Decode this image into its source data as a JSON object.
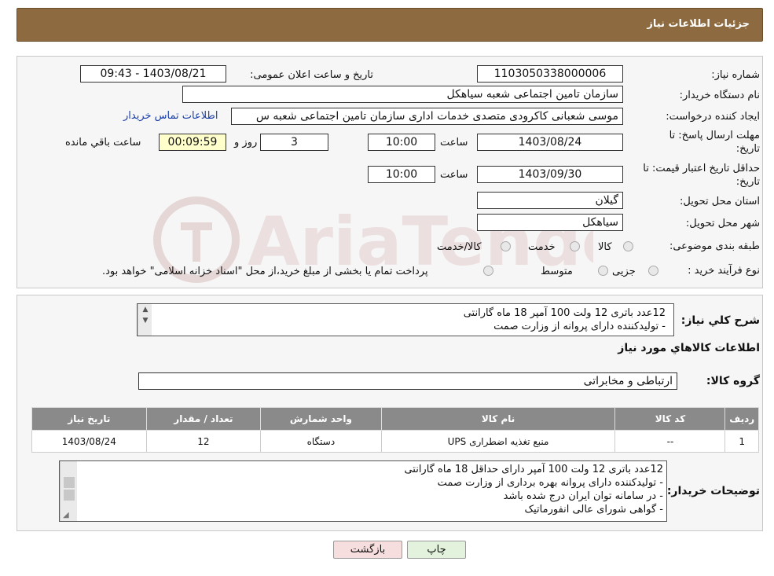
{
  "header": {
    "title": "جزئیات اطلاعات نیاز"
  },
  "form": {
    "need_number_label": "شماره نیاز:",
    "need_number": "1103050338000006",
    "announce_label": "تاریخ و ساعت اعلان عمومی:",
    "announce_value": "1403/08/21 - 09:43",
    "buyer_org_label": "نام دستگاه خریدار:",
    "buyer_org": "سازمان تامین اجتماعی شعبه سیاهکل",
    "creator_label": "ایجاد کننده درخواست:",
    "creator": "موسی شعبانی کاکرودی متصدی خدمات اداری سازمان تامین اجتماعی شعبه س",
    "contact_link": "اطلاعات تماس خریدار",
    "deadline_label": "مهلت ارسال پاسخ: تا",
    "deadline_label2": "تاریخ:",
    "deadline_date": "1403/08/24",
    "time_label": "ساعت",
    "deadline_time": "10:00",
    "days_value": "3",
    "days_label": "روز و",
    "remaining_time": "00:09:59",
    "remaining_label": "ساعت باقي مانده",
    "validity_label": "حداقل تاریخ اعتبار قیمت: تا",
    "validity_label2": "تاریخ:",
    "validity_date": "1403/09/30",
    "validity_time": "10:00",
    "province_label": "استان محل تحویل:",
    "province": "گیلان",
    "city_label": "شهر محل تحویل:",
    "city": "سیاهکل",
    "category_label": "طبقه بندی موضوعی:",
    "category_options": [
      "کالا",
      "خدمت",
      "کالا/خدمت"
    ],
    "process_label": "نوع فرآیند خرید :",
    "process_options": [
      "جزیی",
      "متوسط"
    ],
    "process_note": "پرداخت تمام یا بخشی از مبلغ خرید،از محل \"اسناد خزانه اسلامی\" خواهد بود."
  },
  "watermark": {
    "text": "AriaTender.neT"
  },
  "summary": {
    "label": "شرح کلي نياز:",
    "lines": [
      "12عدد باتری 12 ولت 100 آمپر 18 ماه گارانتی",
      "- تولیدکننده دارای پروانه  از وزارت صمت"
    ]
  },
  "goods": {
    "section_title": "اطلاعات كالاهاي مورد نياز",
    "group_label": "گروه کالا:",
    "group_value": "ارتباطی و مخابراتی",
    "table_headers": [
      "ردیف",
      "کد کالا",
      "نام کالا",
      "واحد شمارش",
      "تعداد / مقدار",
      "تاریخ نیاز"
    ],
    "rows": [
      [
        "1",
        "--",
        "منبع تغذیه اضطراری UPS",
        "دستگاه",
        "12",
        "1403/08/24"
      ]
    ]
  },
  "buyer_notes": {
    "label": "توضیحات خریدار:",
    "lines": [
      "12عدد باتری 12 ولت 100 آمپر دارای حداقل 18 ماه گارانتی",
      "- تولیدکننده دارای پروانه بهره برداری از وزارت صمت",
      "- در سامانه توان ایران درج شده باشد",
      "- گواهی شورای عالی انفورماتیک"
    ]
  },
  "buttons": {
    "print": "چاپ",
    "back": "بازگشت"
  }
}
